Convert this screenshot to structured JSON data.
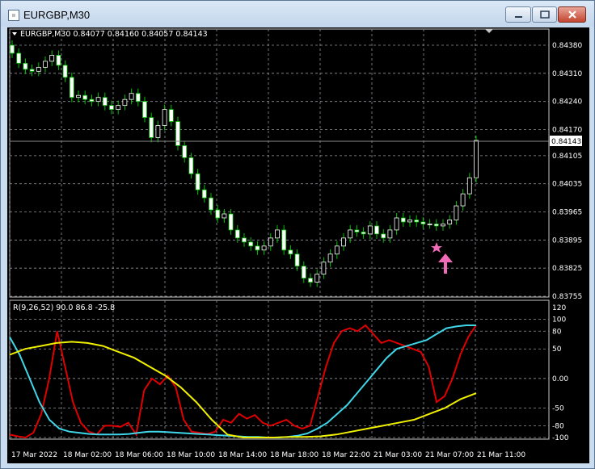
{
  "window": {
    "title": "EURGBP,M30"
  },
  "main_chart": {
    "header": "EURGBP,M30  0.84077 0.84160 0.84057 0.84143",
    "price_labels": [
      "0.84380",
      "0.84310",
      "0.84240",
      "0.84170",
      "0.84105",
      "0.84035",
      "0.83965",
      "0.83895",
      "0.83825",
      "0.83755"
    ],
    "current_price": "0.84143"
  },
  "indicator": {
    "header": "R(9,26,52) 90.0 86.8 -25.8",
    "level_labels": [
      "120",
      "100",
      "80",
      "50",
      "0.00",
      "-50",
      "-80",
      "-100"
    ]
  },
  "time_labels": [
    "17 Mar 2022",
    "18 Mar 02:00",
    "18 Mar 06:00",
    "18 Mar 10:00",
    "18 Mar 14:00",
    "18 Mar 18:00",
    "18 Mar 22:00",
    "21 Mar 03:00",
    "21 Mar 07:00",
    "21 Mar 11:00"
  ],
  "colors": {
    "bull": "#ffffff",
    "bear": "#ffffff",
    "wick": "#00c400",
    "grid": "#9aa0a6",
    "line_red": "#e00000",
    "line_cyan": "#3fd7e8",
    "line_yellow": "#f0f000",
    "marker": "#f06ab8"
  },
  "chart_data": [
    {
      "type": "line",
      "title": "EURGBP,M30",
      "ohlc_note": "close series (0.8xxxx)",
      "y_ticks": [
        0.8438,
        0.8431,
        0.8424,
        0.8417,
        0.84105,
        0.84035,
        0.83965,
        0.83895,
        0.83825,
        0.83755
      ],
      "close": [
        0.8436,
        0.84335,
        0.8432,
        0.84315,
        0.84325,
        0.8434,
        0.84355,
        0.8433,
        0.843,
        0.8425,
        0.84255,
        0.84245,
        0.8424,
        0.8425,
        0.8423,
        0.8422,
        0.8423,
        0.84245,
        0.8426,
        0.8424,
        0.842,
        0.8415,
        0.8418,
        0.8422,
        0.8419,
        0.8413,
        0.841,
        0.8406,
        0.8402,
        0.84,
        0.8397,
        0.8395,
        0.8396,
        0.8392,
        0.839,
        0.8389,
        0.8388,
        0.8387,
        0.8388,
        0.839,
        0.8392,
        0.8387,
        0.8386,
        0.8383,
        0.838,
        0.8379,
        0.8381,
        0.8384,
        0.8386,
        0.8388,
        0.839,
        0.8392,
        0.83915,
        0.8391,
        0.8393,
        0.8391,
        0.839,
        0.8392,
        0.8395,
        0.8394,
        0.83945,
        0.8394,
        0.83935,
        0.83935,
        0.8393,
        0.83935,
        0.83945,
        0.8398,
        0.8401,
        0.8405,
        0.84143
      ]
    },
    {
      "type": "line",
      "title": "R(9,26,52)",
      "ylim": [
        -100,
        120
      ],
      "series": [
        {
          "name": "",
          "values": [
            -95,
            -98,
            -100,
            -92,
            -60,
            0,
            80,
            20,
            -40,
            -75,
            -90,
            -95,
            -80,
            -80,
            -82,
            -75,
            -95,
            -20,
            0,
            -10,
            5,
            -15,
            -70,
            -90,
            -92,
            -94,
            -90,
            -70,
            -75,
            -60,
            -68,
            -62,
            -75,
            -80,
            -75,
            -70,
            -80,
            -85,
            -80,
            -30,
            20,
            60,
            80,
            85,
            80,
            90,
            75,
            60,
            65,
            60,
            55,
            50,
            45,
            20,
            -40,
            -30,
            0,
            40,
            70,
            90
          ]
        },
        {
          "name": "",
          "values": [
            70,
            40,
            0,
            -40,
            -70,
            -85,
            -90,
            -92,
            -94,
            -95,
            -95,
            -95,
            -94,
            -92,
            -90,
            -90,
            -91,
            -92,
            -93,
            -94,
            -95,
            -96,
            -97,
            -98,
            -99,
            -99,
            -100,
            -100,
            -99,
            -97,
            -93,
            -85,
            -75,
            -60,
            -45,
            -25,
            -5,
            15,
            35,
            50,
            55,
            60,
            65,
            75,
            85,
            88,
            90,
            90
          ]
        },
        {
          "name": "",
          "values": [
            40,
            50,
            55,
            60,
            62,
            60,
            55,
            45,
            35,
            20,
            5,
            -15,
            -40,
            -70,
            -95,
            -100,
            -100,
            -100,
            -99,
            -99,
            -98,
            -95,
            -90,
            -85,
            -80,
            -75,
            -70,
            -60,
            -50,
            -35,
            -25
          ]
        }
      ]
    }
  ]
}
